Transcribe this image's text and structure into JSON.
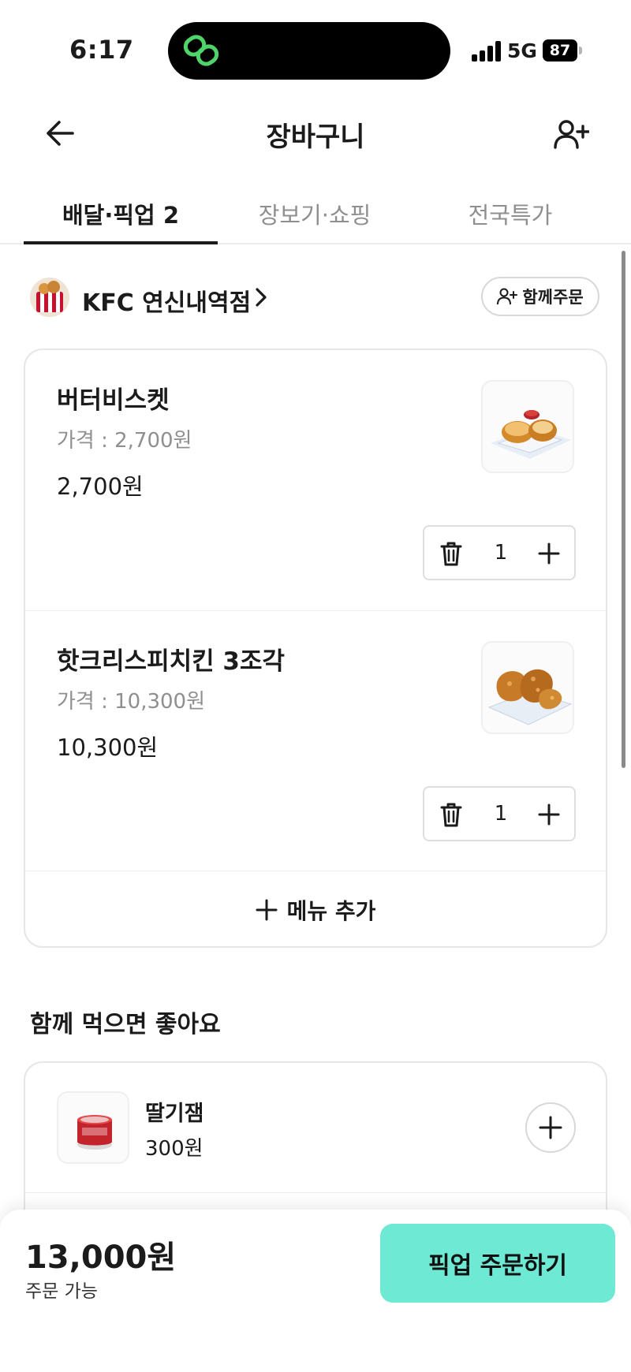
{
  "status_bar": {
    "time": "6:17",
    "network": "5G",
    "battery": "87"
  },
  "header": {
    "title": "장바구니"
  },
  "tabs": [
    {
      "label": "배달·픽업 2",
      "active": true
    },
    {
      "label": "장보기·쇼핑",
      "active": false
    },
    {
      "label": "전국특가",
      "active": false
    }
  ],
  "store": {
    "name": "KFC 연신내역점",
    "group_order_label": "함께주문"
  },
  "cart": {
    "items": [
      {
        "name": "버터비스켓",
        "price_label": "가격 : 2,700원",
        "total": "2,700원",
        "quantity": "1"
      },
      {
        "name": "핫크리스피치킨 3조각",
        "price_label": "가격 : 10,300원",
        "total": "10,300원",
        "quantity": "1"
      }
    ],
    "add_menu_label": "메뉴 추가"
  },
  "recommendations": {
    "title": "함께 먹으면 좋아요",
    "items": [
      {
        "name": "딸기잼",
        "price": "300원"
      }
    ]
  },
  "bottom_bar": {
    "total": "13,000원",
    "status": "주문 가능",
    "order_button": "픽업 주문하기"
  },
  "colors": {
    "accent": "#6ee9d3",
    "text": "#1b1b1b",
    "muted": "#8f8f8f"
  }
}
